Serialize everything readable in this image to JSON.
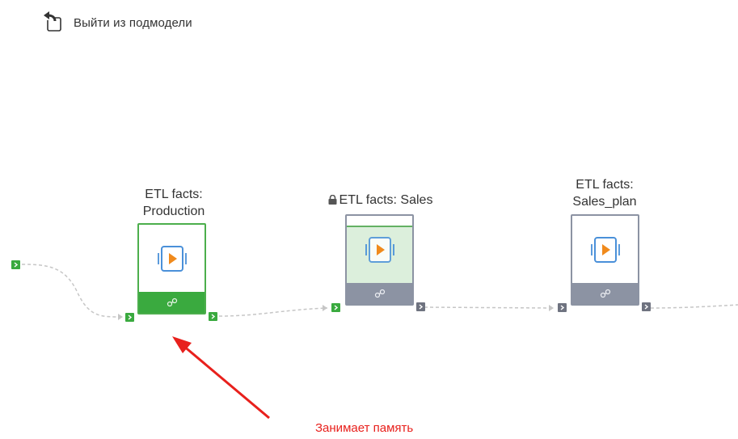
{
  "exit_submodel": {
    "label": "Выйти из подмодели",
    "icon": "back-arrow-icon"
  },
  "nodes": [
    {
      "id": "production",
      "title_line1": "ETL facts:",
      "title_line2": "Production",
      "state": "active",
      "locked": false,
      "color": "#3aaa3f"
    },
    {
      "id": "sales",
      "title_line1": "ETL facts: Sales",
      "title_line2": "",
      "state": "running",
      "locked": true,
      "progress": 0.85,
      "color": "#8c93a3"
    },
    {
      "id": "sales_plan",
      "title_line1": "ETL facts:",
      "title_line2": "Sales_plan",
      "state": "idle",
      "locked": false,
      "color": "#8c93a3"
    }
  ],
  "annotation": {
    "text": "Занимает память",
    "color": "#e8201c"
  },
  "colors": {
    "accent_green": "#3aaa3f",
    "node_gray": "#8c93a3",
    "port_gray": "#6f7380",
    "arrow_red": "#e8201c",
    "play_orange": "#f08a1c",
    "play_blue": "#4a90d9"
  }
}
